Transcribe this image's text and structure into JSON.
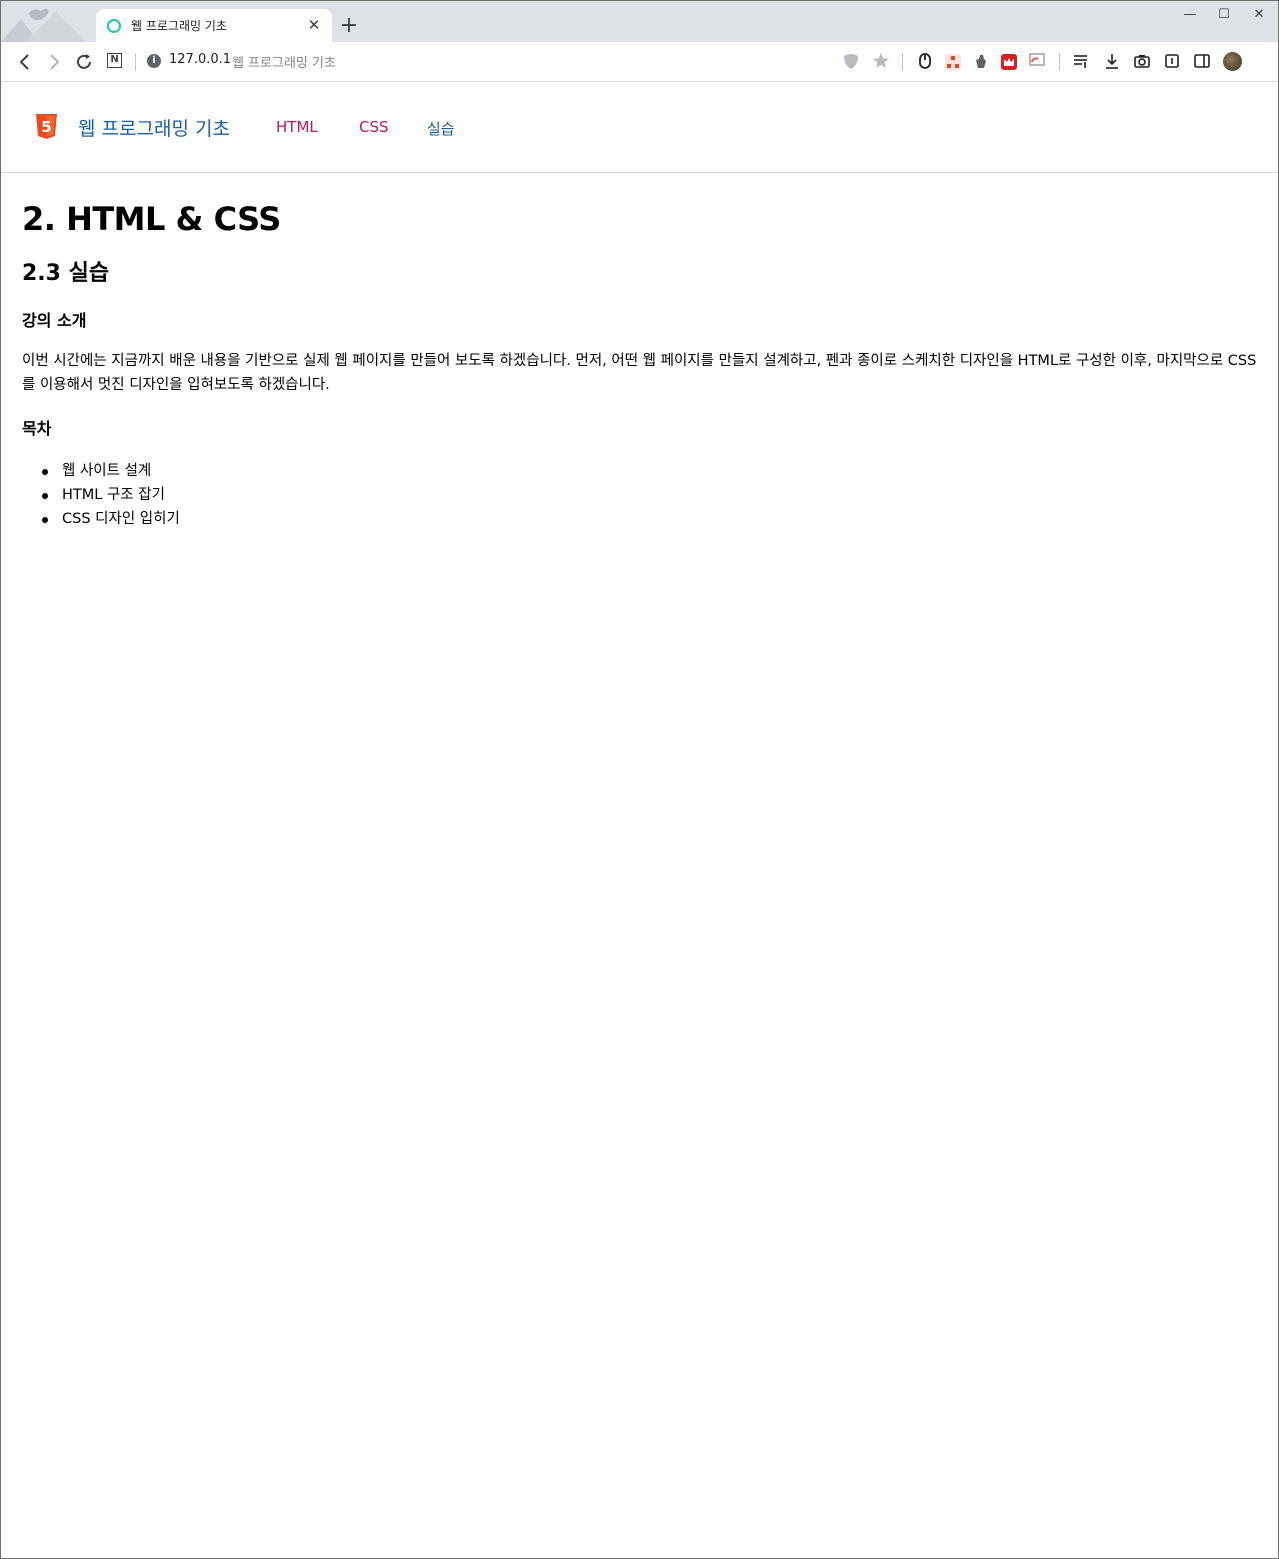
{
  "browser": {
    "tab": {
      "title": "웹 프로그래밍 기초",
      "close_label": "✕"
    },
    "new_tab_label": "+",
    "window_controls": {
      "minimize": "—",
      "maximize": "☐",
      "close": "✕"
    },
    "address": {
      "host": "127.0.0.1",
      "page_title": "웹 프로그래밍 기초"
    }
  },
  "site": {
    "brand": "웹 프로그래밍 기초",
    "nav": [
      {
        "label": "HTML",
        "color": "#c2185b"
      },
      {
        "label": "CSS",
        "color": "#c2185b"
      },
      {
        "label": "실습",
        "color": "#1a5fa6"
      }
    ],
    "brand_color": "#1a5fa6",
    "logo_color": "#e44d26"
  },
  "main": {
    "h1": "2. HTML & CSS",
    "h2": "2.3 실습",
    "intro_heading": "강의 소개",
    "intro_text": "이번 시간에는 지금까지 배운 내용을 기반으로 실제 웹 페이지를 만들어 보도록 하겠습니다. 먼저, 어떤 웹 페이지를 만들지 설계하고, 펜과 종이로 스케치한 디자인을 HTML로 구성한 이후, 마지막으로 CSS를 이용해서 멋진 디자인을 입혀보도록 하겠습니다.",
    "toc_heading": "목차",
    "toc": [
      "웹 사이트 설계",
      "HTML 구조 잡기",
      "CSS 디자인 입히기"
    ]
  }
}
